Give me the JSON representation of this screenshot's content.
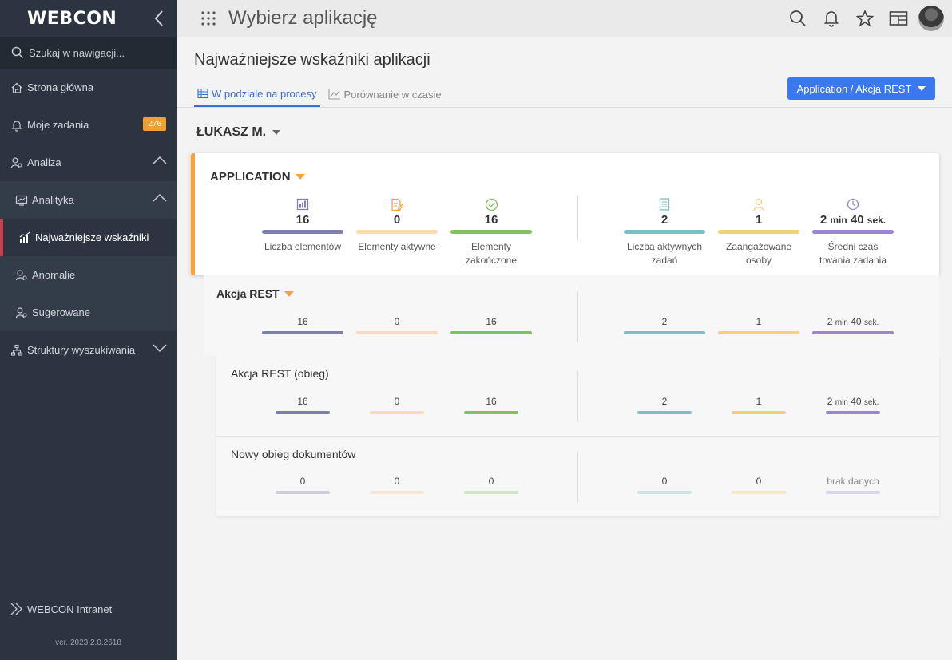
{
  "sidebar": {
    "logo": "WEBCON",
    "search_placeholder": "Szukaj w nawigacji...",
    "items": {
      "home": "Strona główna",
      "tasks": "Moje zadania",
      "tasks_badge": "276",
      "analysis": "Analiza",
      "analytics": "Analityka",
      "kpi": "Najważniejsze wskaźniki",
      "anomalies": "Anomalie",
      "suggested": "Sugerowane",
      "search_structures": "Struktury wyszukiwania"
    },
    "intranet": "WEBCON Intranet",
    "version": "ver. 2023.2.0.2618"
  },
  "topbar": {
    "title": "Wybierz aplikację"
  },
  "main": {
    "page_title": "Najważniejsze wskaźniki aplikacji",
    "tabs": [
      "W podziale na procesy",
      "Porównanie w czasie"
    ],
    "process_select": "Application / Akcja REST",
    "user": "ŁUKASZ M."
  },
  "application": {
    "title": "APPLICATION",
    "metrics": [
      {
        "icon": "chart-icon",
        "value": "16",
        "label": "Liczba elementów",
        "color": "#7f7fae",
        "fill": 1.0
      },
      {
        "icon": "document-edit-icon",
        "value": "0",
        "label": "Elementy aktywne",
        "color": "#f9dcb3",
        "fill": 1.0
      },
      {
        "icon": "check-circle-icon",
        "value": "16",
        "label": "Elementy zakończone",
        "color": "#86bf63",
        "fill": 1.0
      },
      {
        "icon": "list-icon",
        "value": "2",
        "label": "Liczba aktywnych zadań",
        "color": "#7fbec4",
        "fill": 1.0
      },
      {
        "icon": "person-icon",
        "value": "1",
        "label": "Zaangażowane osoby",
        "color": "#efd37b",
        "fill": 1.0
      },
      {
        "icon": "clock-icon",
        "value_a": "2",
        "unit_a": "min",
        "value_b": "40",
        "unit_b": "sek.",
        "label": "Średni czas trwania zadania",
        "color": "#9b87d1",
        "fill": 1.0
      }
    ]
  },
  "akcja_rest": {
    "title": "Akcja REST",
    "values": [
      "16",
      "0",
      "16",
      "2",
      "1"
    ],
    "time": {
      "a": "2",
      "unit_a": "min",
      "b": "40",
      "unit_b": "sek."
    }
  },
  "akcja_rest_obieg": {
    "title": "Akcja REST (obieg)",
    "values": [
      "16",
      "0",
      "16",
      "2",
      "1"
    ],
    "time": {
      "a": "2",
      "unit_a": "min",
      "b": "40",
      "unit_b": "sek."
    }
  },
  "nowy_obieg": {
    "title": "Nowy obieg dokumentów",
    "values": [
      "0",
      "0",
      "0",
      "0",
      "0"
    ],
    "no_data": "brak danych"
  },
  "colors": {
    "accent": "#3b77f0",
    "highlight": "#f7a53a",
    "sidebar": "#2b3440",
    "active_marker": "#c8414a"
  }
}
